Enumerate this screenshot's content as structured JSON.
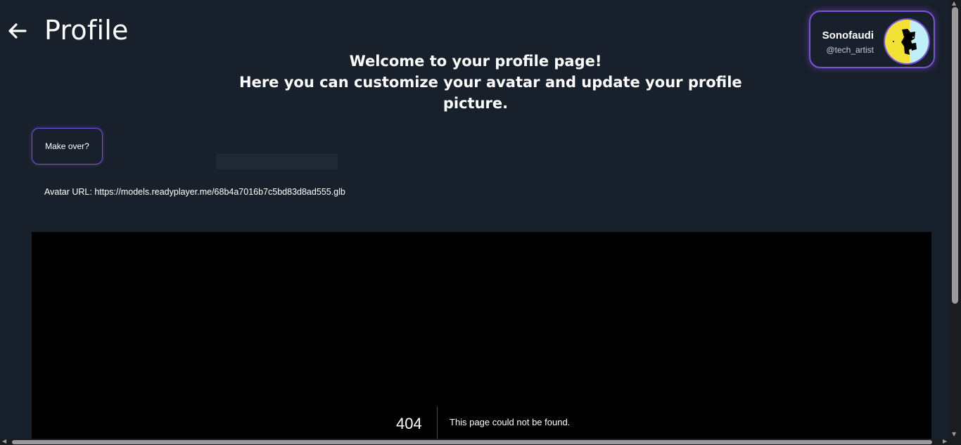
{
  "header": {
    "title": "Profile",
    "back_icon": "arrow-left-icon"
  },
  "welcome": {
    "line1": "Welcome to your profile page!",
    "line2": "Here you can customize your avatar and update your profile",
    "line3": "picture."
  },
  "user": {
    "name": "Sonofaudi",
    "handle": "@tech_artist",
    "avatar_icon": "user-avatar-image"
  },
  "actions": {
    "make_over_label": "Make over?"
  },
  "avatar": {
    "url_text": "Avatar URL: https://models.readyplayer.me/68b4a7016b7c5bd83d8ad555.glb"
  },
  "viewer": {
    "error_code": "404",
    "error_message": "This page could not be found."
  },
  "colors": {
    "background": "#18202b",
    "accent": "#7b52d8",
    "viewer_bg": "#000000"
  }
}
